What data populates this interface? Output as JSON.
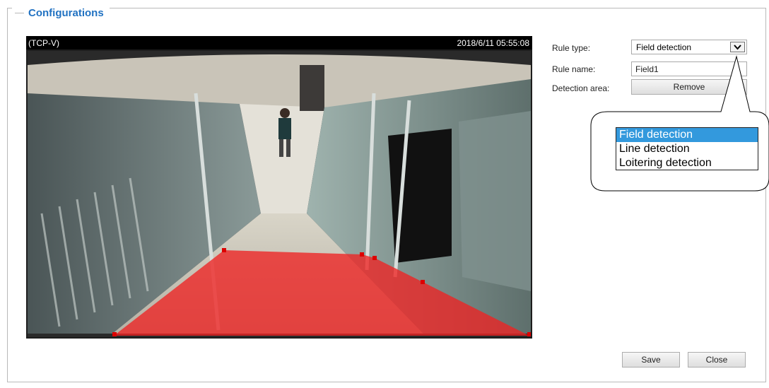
{
  "section": {
    "title": "Configurations"
  },
  "video": {
    "label": "(TCP-V)",
    "timestamp": "2018/6/11 05:55:08"
  },
  "form": {
    "rule_type_label": "Rule type:",
    "rule_type_value": "Field detection",
    "rule_name_label": "Rule name:",
    "rule_name_value": "Field1",
    "detection_area_label": "Detection area:",
    "remove_label": "Remove"
  },
  "dropdown": {
    "options": [
      "Field detection",
      "Line detection",
      "Loitering detection"
    ],
    "selected": "Field detection"
  },
  "buttons": {
    "save_label": "Save",
    "close_label": "Close"
  },
  "colors": {
    "accent": "#2172c2",
    "detection_area": "#ee2222",
    "option_highlight": "#3399dd"
  }
}
